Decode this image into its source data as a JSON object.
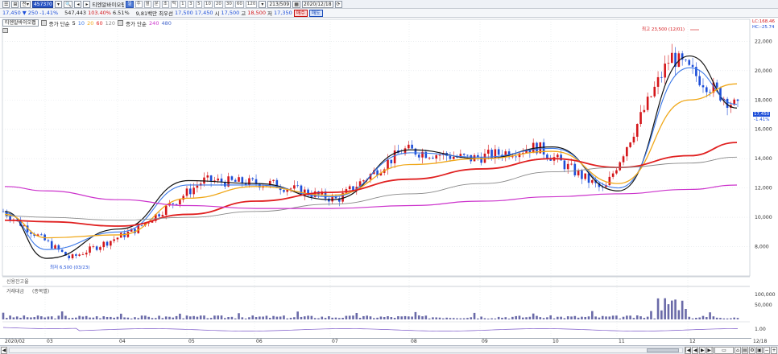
{
  "toolbar1": {
    "code": "457370",
    "stock_name": "티엔알바이오팹",
    "period_buttons": [
      "1",
      "3",
      "5",
      "10",
      "20",
      "30",
      "60",
      "120"
    ],
    "period_active": "일",
    "period_labels": [
      "일",
      "주",
      "월",
      "분",
      "초",
      "틱"
    ],
    "count": "213/509",
    "date": "2020/12/18"
  },
  "toolbar2": {
    "price": "17,450",
    "change": "250",
    "change_pct": "-1.41%",
    "volume": "547,443",
    "vol_ratio": "103.40%",
    "turnover": "6.51%",
    "amount": "9,81백만",
    "bid_label": "최우선",
    "bid": "17,500",
    "ask": "17,450",
    "open_label": "시",
    "open": "17,500",
    "high_label": "고",
    "high": "18,500",
    "low_label": "저",
    "low": "17,350",
    "buy_label": "매수",
    "sell_label": "매도"
  },
  "legend": {
    "name": "티엔알바이오팹",
    "ma_label": "증가 단순",
    "ma_periods": [
      "5",
      "10",
      "20",
      "60",
      "120"
    ],
    "ma2_label": "증가 단순",
    "ma2_periods": [
      "240",
      "480"
    ]
  },
  "annotations": {
    "high_note": "최고 23,500 (12/01)",
    "low_note": "최저 6,500 (03/23)"
  },
  "price_axis": {
    "ticks": [
      "22,000",
      "20,000",
      "18,000",
      "16,000",
      "14,000",
      "12,000",
      "10,000",
      "8,000"
    ],
    "current": "17,450",
    "current_pct": "-1.41%",
    "lc": "LC:168.46",
    "hc": "HC:-25.74"
  },
  "sub_panels": {
    "credit": "신용잔고율",
    "volume_title": "거래대금",
    "volume_sub": "(종목별)",
    "vol_ticks": [
      "100,000",
      "50,000"
    ],
    "ratio_tick": "1.00"
  },
  "x_axis": {
    "labels": [
      "2020/02",
      "03",
      "04",
      "05",
      "06",
      "07",
      "08",
      "09",
      "10",
      "11",
      "12",
      "12/18"
    ]
  },
  "colors": {
    "up": "#d4161a",
    "down": "#1d4ed8",
    "ma5": "#111111",
    "ma10": "#3b78e7",
    "ma20": "#f0a81a",
    "ma60": "#e02020",
    "ma120": "#888888",
    "ma240": "#cc33cc",
    "ma480": "#4466cc"
  },
  "chart_data": {
    "type": "line",
    "x": [
      "2020-02",
      "2020-03",
      "2020-04",
      "2020-05",
      "2020-06",
      "2020-07",
      "2020-08",
      "2020-09",
      "2020-10",
      "2020-11",
      "2020-12",
      "2020-12-18"
    ],
    "series": [
      {
        "name": "5",
        "values": [
          10400,
          7200,
          9200,
          12500,
          12300,
          11200,
          14600,
          14000,
          14800,
          11800,
          21000,
          17450
        ]
      },
      {
        "name": "10",
        "values": [
          10300,
          7800,
          9000,
          12200,
          12200,
          11400,
          14400,
          14100,
          14700,
          12000,
          20200,
          17700
        ]
      },
      {
        "name": "20",
        "values": [
          10200,
          8600,
          8800,
          11300,
          12100,
          11500,
          13600,
          14000,
          14500,
          12300,
          18000,
          19100
        ]
      },
      {
        "name": "60",
        "values": [
          9800,
          9700,
          9400,
          10200,
          11100,
          11700,
          12600,
          13300,
          14000,
          13400,
          14200,
          15100
        ]
      },
      {
        "name": "120",
        "values": [
          10100,
          10000,
          9800,
          10000,
          10400,
          10900,
          11600,
          12300,
          13100,
          13400,
          13700,
          14100
        ]
      },
      {
        "name": "240",
        "values": [
          12100,
          11800,
          11200,
          10800,
          10600,
          10600,
          10800,
          11100,
          11400,
          11600,
          11900,
          12200
        ]
      }
    ],
    "ylim": [
      6000,
      23500
    ],
    "grid": true,
    "high": 23500,
    "low": 6500
  }
}
